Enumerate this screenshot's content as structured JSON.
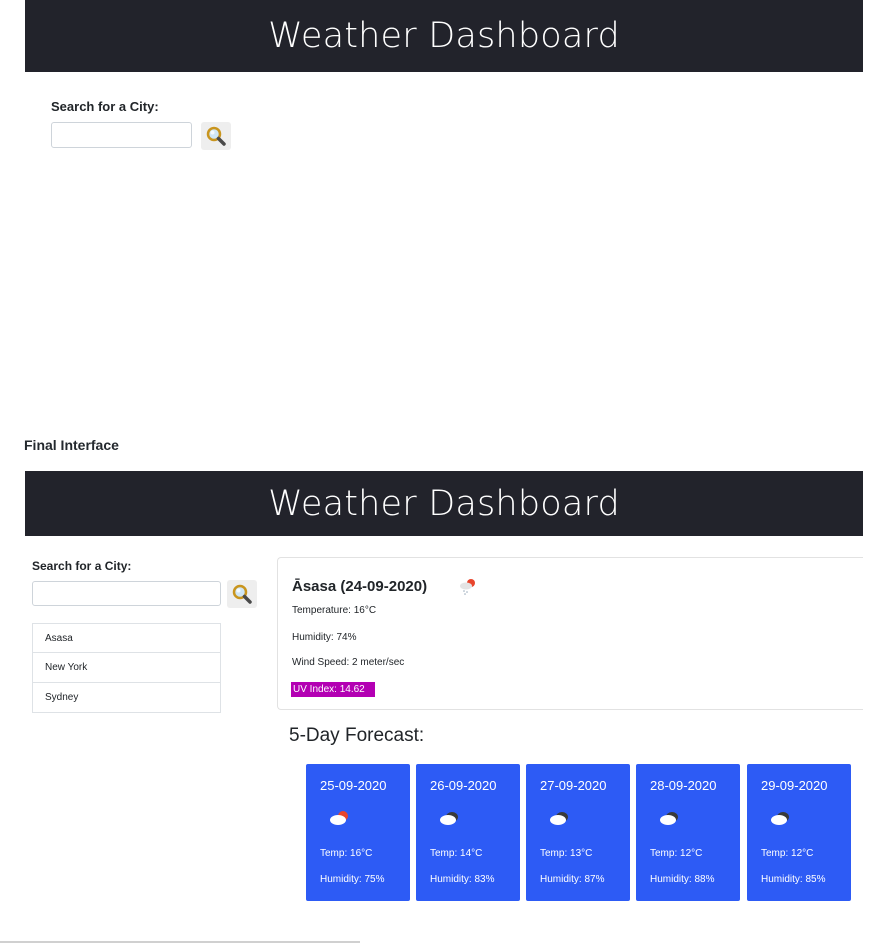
{
  "top_screen": {
    "header_title": "Weather Dashboard",
    "search_label": "Search for a City:",
    "search_value": ""
  },
  "caption": "Final Interface",
  "final_screen": {
    "header_title": "Weather Dashboard",
    "search_label": "Search for a City:",
    "search_value": "",
    "history": [
      {
        "label": "Asasa"
      },
      {
        "label": "New York"
      },
      {
        "label": "Sydney"
      }
    ],
    "current": {
      "title": "Āsasa (24-09-2020)",
      "icon": "rain-cloud-icon",
      "temperature": "Temperature: 16°C",
      "humidity": "Humidity: 74%",
      "wind": "Wind Speed: 2 meter/sec",
      "uv": "UV Index: 14.62",
      "uv_color": "#b300b3"
    },
    "forecast_title": "5-Day Forecast:",
    "forecast_color": "#2d5bf5",
    "forecast": [
      {
        "date": "25-09-2020",
        "icon": "sun-cloud-icon",
        "temp": "Temp: 16°C",
        "humidity": "Humidity: 75%"
      },
      {
        "date": "26-09-2020",
        "icon": "cloud-icon",
        "temp": "Temp: 14°C",
        "humidity": "Humidity: 83%"
      },
      {
        "date": "27-09-2020",
        "icon": "cloud-icon",
        "temp": "Temp: 13°C",
        "humidity": "Humidity: 87%"
      },
      {
        "date": "28-09-2020",
        "icon": "cloud-icon",
        "temp": "Temp: 12°C",
        "humidity": "Humidity: 88%"
      },
      {
        "date": "29-09-2020",
        "icon": "cloud-icon",
        "temp": "Temp: 12°C",
        "humidity": "Humidity: 85%"
      }
    ]
  }
}
